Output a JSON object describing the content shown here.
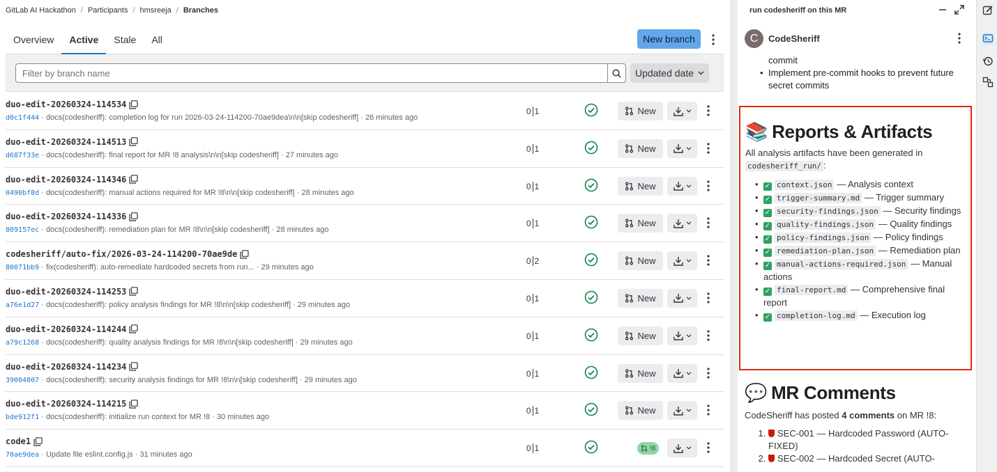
{
  "breadcrumb": [
    "GitLab AI Hackathon",
    "Participants",
    "hmsreeja",
    "Branches"
  ],
  "tabs": [
    {
      "label": "Overview",
      "active": false
    },
    {
      "label": "Active",
      "active": true
    },
    {
      "label": "Stale",
      "active": false
    },
    {
      "label": "All",
      "active": false
    }
  ],
  "new_branch_label": "New branch",
  "filter": {
    "placeholder": "Filter by branch name"
  },
  "sort": {
    "label": "Updated date"
  },
  "new_mr_label": "New",
  "branches": [
    {
      "name": "duo-edit-20260324-114534",
      "sha": "d0c1f444",
      "message": "docs(codesheriff): completion log for run 2026-03-24-114200-70ae9dea\\n\\n[skip codesheriff]",
      "time": "26 minutes ago",
      "behind": "0",
      "ahead": "1",
      "mr_badge": ""
    },
    {
      "name": "duo-edit-20260324-114513",
      "sha": "d687f33e",
      "message": "docs(codesheriff): final report for MR !8 analysis\\n\\n[skip codesheriff]",
      "time": "27 minutes ago",
      "behind": "0",
      "ahead": "1",
      "mr_badge": ""
    },
    {
      "name": "duo-edit-20260324-114346",
      "sha": "0490bf8d",
      "message": "docs(codesheriff): manual actions required for MR !8\\n\\n[skip codesheriff]",
      "time": "28 minutes ago",
      "behind": "0",
      "ahead": "1",
      "mr_badge": ""
    },
    {
      "name": "duo-edit-20260324-114336",
      "sha": "809157ec",
      "message": "docs(codesheriff): remediation plan for MR !8\\n\\n[skip codesheriff]",
      "time": "28 minutes ago",
      "behind": "0",
      "ahead": "1",
      "mr_badge": ""
    },
    {
      "name": "codesheriff/auto-fix/2026-03-24-114200-70ae9de",
      "sha": "80071bb9",
      "message": "fix(codesheriff): auto-remediate hardcoded secrets from run...",
      "time": "29 minutes ago",
      "behind": "0",
      "ahead": "2",
      "mr_badge": ""
    },
    {
      "name": "duo-edit-20260324-114253",
      "sha": "a76e1d27",
      "message": "docs(codesheriff): policy analysis findings for MR !8\\n\\n[skip codesheriff]",
      "time": "29 minutes ago",
      "behind": "0",
      "ahead": "1",
      "mr_badge": ""
    },
    {
      "name": "duo-edit-20260324-114244",
      "sha": "a79c1268",
      "message": "docs(codesheriff): quality analysis findings for MR !8\\n\\n[skip codesheriff]",
      "time": "29 minutes ago",
      "behind": "0",
      "ahead": "1",
      "mr_badge": ""
    },
    {
      "name": "duo-edit-20260324-114234",
      "sha": "39004807",
      "message": "docs(codesheriff): security analysis findings for MR !8\\n\\n[skip codesheriff]",
      "time": "29 minutes ago",
      "behind": "0",
      "ahead": "1",
      "mr_badge": ""
    },
    {
      "name": "duo-edit-20260324-114215",
      "sha": "bde912f1",
      "message": "docs(codesheriff): initialize run context for MR !8",
      "time": "30 minutes ago",
      "behind": "0",
      "ahead": "1",
      "mr_badge": ""
    },
    {
      "name": "code1",
      "sha": "70ae9dea",
      "message": "Update file eslint.config.js",
      "time": "31 minutes ago",
      "behind": "0",
      "ahead": "1",
      "mr_badge": "!8"
    }
  ],
  "duo": {
    "title": "run codesheriff on this MR",
    "agent_initial": "C",
    "agent_name": "CodeSheriff",
    "prev_tail": "commit",
    "prev_item": "Implement pre-commit hooks to prevent future secret commits",
    "reports": {
      "emoji": "📚",
      "title": "Reports & Artifacts",
      "intro": "All analysis artifacts have been generated in",
      "dir": "codesheriff_run/",
      "colon": ":",
      "items": [
        {
          "file": "context.json",
          "desc": "— Analysis context"
        },
        {
          "file": "trigger-summary.md",
          "desc": "— Trigger summary"
        },
        {
          "file": "security-findings.json",
          "desc": "— Security findings"
        },
        {
          "file": "quality-findings.json",
          "desc": "— Quality findings"
        },
        {
          "file": "policy-findings.json",
          "desc": "— Policy findings"
        },
        {
          "file": "remediation-plan.json",
          "desc": "— Remediation plan"
        },
        {
          "file": "manual-actions-required.json",
          "desc": "— Manual actions"
        },
        {
          "file": "final-report.md",
          "desc": "— Comprehensive final report"
        },
        {
          "file": "completion-log.md",
          "desc": "— Execution log"
        }
      ]
    },
    "comments": {
      "emoji": "💬",
      "title": "MR Comments",
      "pre": "CodeSheriff has posted",
      "count": "4 comments",
      "post": "on MR !8:",
      "items": [
        "SEC-001 — Hardcoded Password (AUTO-FIXED)",
        "SEC-002 — Hardcoded Secret (AUTO-"
      ]
    }
  },
  "colors": {
    "accent": "#1f75cb",
    "primary_button": "#63a6e9",
    "success": "#108548",
    "highlight_border": "#dd2b0e"
  }
}
